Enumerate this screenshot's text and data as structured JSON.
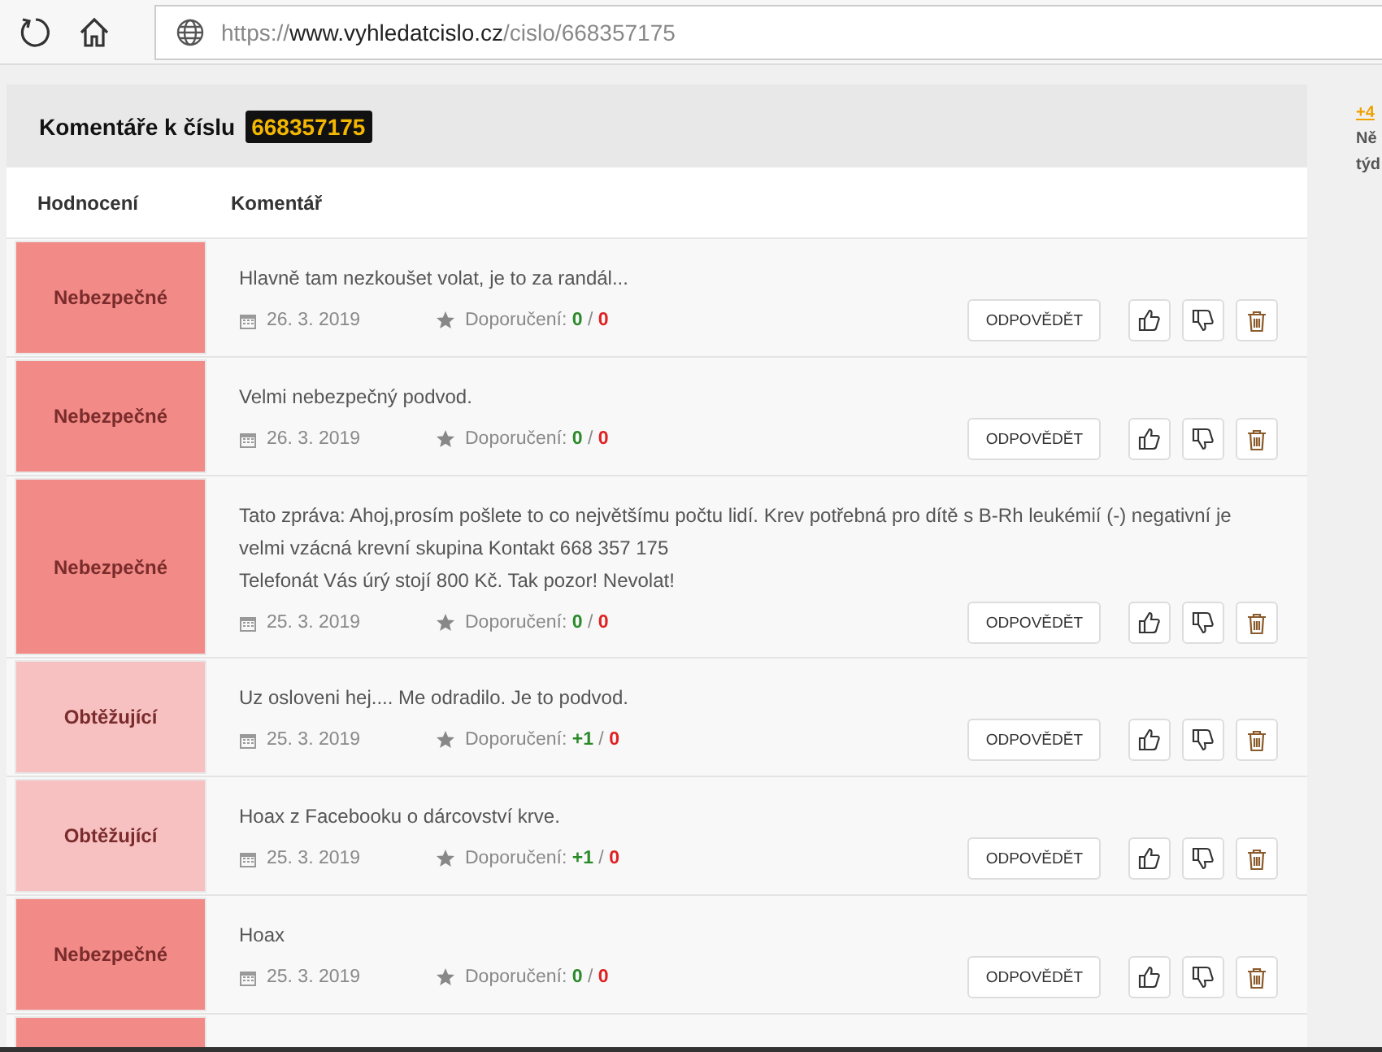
{
  "browser": {
    "url_scheme": "https://",
    "url_host": "www.vyhledatcislo.cz",
    "url_path": "/cislo/668357175"
  },
  "panel": {
    "title": "Komentáře k číslu",
    "number": "668357175"
  },
  "columns": [
    "Hodnocení",
    "Komentář"
  ],
  "comments": [
    {
      "rating": "Nebezpečné",
      "kind": "danger",
      "lines": [
        "Hlavně tam nezkoušet volat, je to za randál..."
      ],
      "date": "26. 3. 2019",
      "recommend_label": "Doporučení:",
      "separator": "/",
      "up": "0",
      "down": "0",
      "reply": "ODPOVĚDĚT"
    },
    {
      "rating": "Nebezpečné",
      "kind": "danger",
      "lines": [
        "Velmi nebezpečný podvod."
      ],
      "date": "26. 3. 2019",
      "recommend_label": "Doporučení:",
      "separator": "/",
      "up": "0",
      "down": "0",
      "reply": "ODPOVĚDĚT"
    },
    {
      "rating": "Nebezpečné",
      "kind": "danger",
      "lines": [
        "Tato zpráva: Ahoj,prosím pošlete to co největšímu počtu lidí. Krev potřebná pro dítě s B-Rh leukémií (-) negativní je velmi vzácná krevní skupina Kontakt 668 357 175",
        "Telefonát Vás úrý stojí 800 Kč. Tak pozor! Nevolat!"
      ],
      "date": "25. 3. 2019",
      "recommend_label": "Doporučení:",
      "separator": "/",
      "up": "0",
      "down": "0",
      "reply": "ODPOVĚDĚT"
    },
    {
      "rating": "Obtěžující",
      "kind": "annoying",
      "lines": [
        "Uz osloveni hej.... Me odradilo. Je to podvod."
      ],
      "date": "25. 3. 2019",
      "recommend_label": "Doporučení:",
      "separator": "/",
      "up": "+1",
      "down": "0",
      "reply": "ODPOVĚDĚT"
    },
    {
      "rating": "Obtěžující",
      "kind": "annoying",
      "lines": [
        "Hoax z Facebooku o dárcovství krve."
      ],
      "date": "25. 3. 2019",
      "recommend_label": "Doporučení:",
      "separator": "/",
      "up": "+1",
      "down": "0",
      "reply": "ODPOVĚDĚT"
    },
    {
      "rating": "Nebezpečné",
      "kind": "danger",
      "lines": [
        "Hoax"
      ],
      "date": "25. 3. 2019",
      "recommend_label": "Doporučení:",
      "separator": "/",
      "up": "0",
      "down": "0",
      "reply": "ODPOVĚDĚT"
    }
  ],
  "partial_row": {
    "kind": "danger"
  },
  "sidebar": {
    "link": "+4",
    "line_1": "Ně",
    "line_2": "týd"
  }
}
